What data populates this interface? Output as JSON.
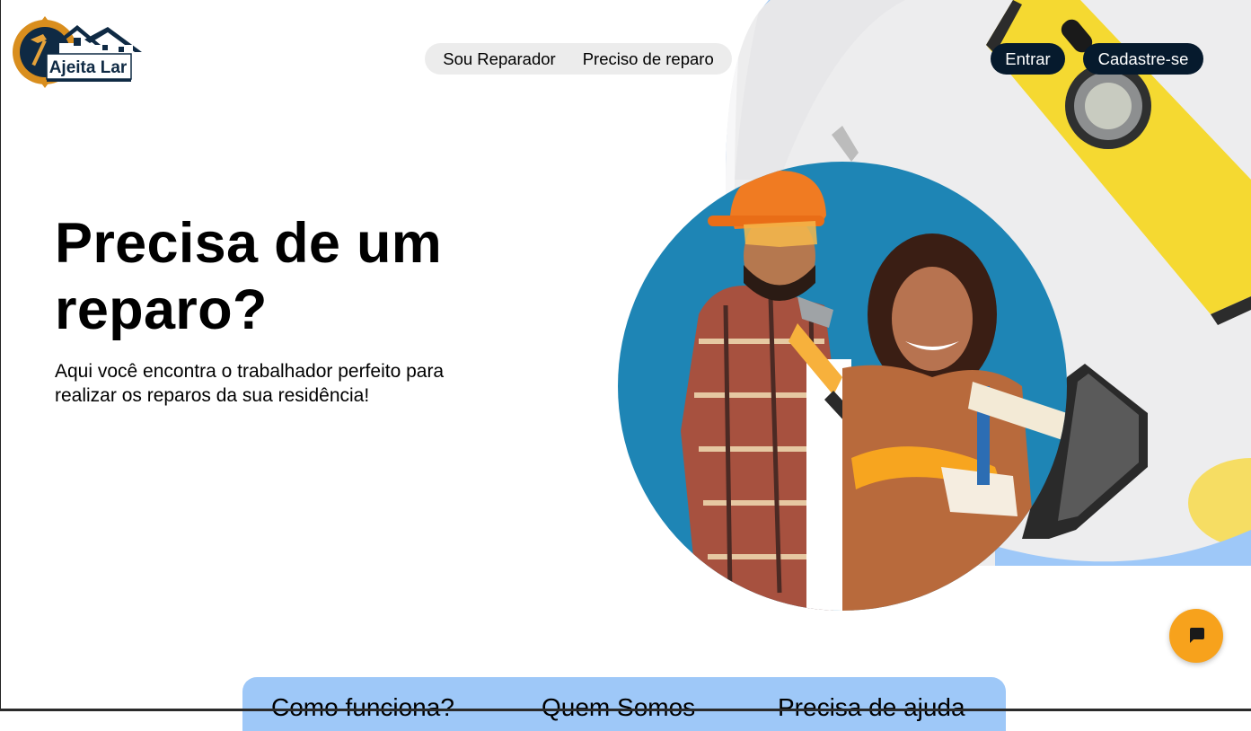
{
  "brand": {
    "logo_text": "Ajeita Lar"
  },
  "nav": {
    "items": [
      {
        "label": "Sou Reparador"
      },
      {
        "label": "Preciso de reparo"
      }
    ]
  },
  "auth": {
    "login_label": "Entrar",
    "signup_label": "Cadastre-se"
  },
  "hero": {
    "title_line1": "Precisa de um",
    "title_line2": "reparo?",
    "subtitle_line1": "Aqui você encontra o trabalhador perfeito para",
    "subtitle_line2": "realizar os reparos da sua residência!"
  },
  "bottom_nav": {
    "items": [
      {
        "label": "Como funciona?"
      },
      {
        "label": "Quem Somos"
      },
      {
        "label": "Precisa de ajuda"
      }
    ]
  },
  "icons": {
    "chat": "chat-bubble-icon",
    "logo": "saw-house-logo"
  },
  "colors": {
    "dark_button": "#061a2d",
    "chat_button": "#f7a21c",
    "bottom_nav_bg": "#9ec8f8",
    "nav_pill_bg": "#ececec",
    "circle_blue": "#1e85b5",
    "arc_blue": "#9ec8f8"
  }
}
